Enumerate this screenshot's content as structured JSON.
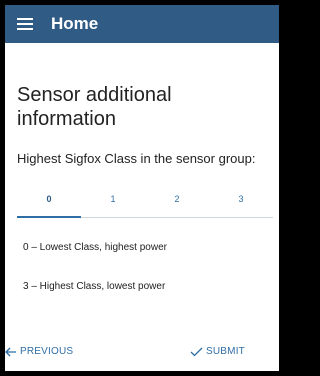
{
  "appbar": {
    "title": "Home",
    "menu_icon": "hamburger-menu-icon"
  },
  "page": {
    "heading": "Sensor additional information",
    "question": "Highest Sigfox Class in the sensor group:"
  },
  "class_selector": {
    "options": [
      "0",
      "1",
      "2",
      "3"
    ],
    "selected": "0"
  },
  "legend": [
    "0 – Lowest Class, highest power",
    "3 – Highest Class, lowest power"
  ],
  "footer": {
    "previous_label": "PREVIOUS",
    "previous_icon": "arrow-left-icon",
    "submit_label": "SUBMIT",
    "submit_icon": "checkmark-icon"
  },
  "colors": {
    "appbar": "#2f5b85",
    "accent": "#2f6ea5"
  }
}
